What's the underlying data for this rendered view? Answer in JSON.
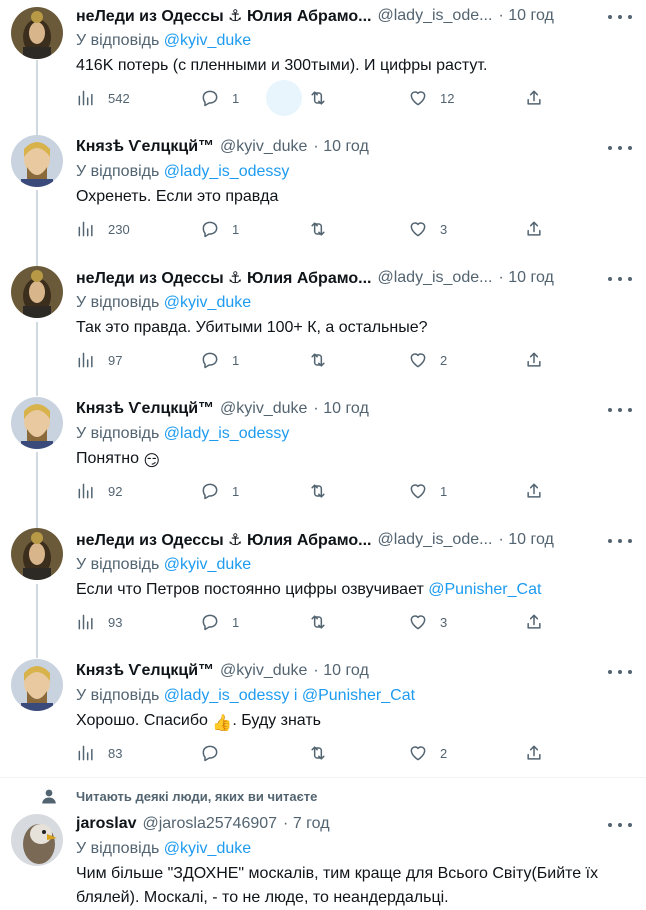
{
  "labels": {
    "replying_to": "У відповідь",
    "and": "і"
  },
  "tweets": [
    {
      "display_name": "неЛеди из Одессы ⚓ Юлия Абрамо...",
      "handle": "@lady_is_ode...",
      "time": "· 10 год",
      "reply_to_1": "@kyiv_duke",
      "text": "416K потерь (с пленными и 300тыми). И цифры растут.",
      "views": "542",
      "replies": "1",
      "retweets": "",
      "likes": "12"
    },
    {
      "display_name": "Князѣ Ѵелцкцй™",
      "handle": "@kyiv_duke",
      "time": "· 10 год",
      "reply_to_1": "@lady_is_odessy",
      "text": "Охренеть. Если это правда",
      "views": "230",
      "replies": "1",
      "retweets": "",
      "likes": "3"
    },
    {
      "display_name": "неЛеди из Одессы ⚓ Юлия Абрамо...",
      "handle": "@lady_is_ode...",
      "time": "· 10 год",
      "reply_to_1": "@kyiv_duke",
      "text": "Так это правда. Убитыми 100+ К, а остальные?",
      "views": "97",
      "replies": "1",
      "retweets": "",
      "likes": "2"
    },
    {
      "display_name": "Князѣ Ѵелцкцй™",
      "handle": "@kyiv_duke",
      "time": "· 10 год",
      "reply_to_1": "@lady_is_odessy",
      "text": "Понятно",
      "emoji": "😏",
      "views": "92",
      "replies": "1",
      "retweets": "",
      "likes": "1"
    },
    {
      "display_name": "неЛеди из Одессы ⚓ Юлия Абрамо...",
      "handle": "@lady_is_ode...",
      "time": "· 10 год",
      "reply_to_1": "@kyiv_duke",
      "text": "Если что Петров постоянно цифры озвучивает",
      "text_mention": "@Punisher_Cat",
      "views": "93",
      "replies": "1",
      "retweets": "",
      "likes": "3"
    },
    {
      "display_name": "Князѣ Ѵелцкцй™",
      "handle": "@kyiv_duke",
      "time": "· 10 год",
      "reply_to_1": "@lady_is_odessy",
      "reply_to_2": "@Punisher_Cat",
      "text": "Хорошо. Спасибо",
      "emoji": "👍",
      "text_after": ". Буду знать",
      "views": "83",
      "replies": "",
      "retweets": "",
      "likes": "2"
    }
  ],
  "social_context": "Читають деякі люди, яких ви читаєте",
  "last_tweet": {
    "display_name": "jaroslav",
    "handle": "@jarosla25746907",
    "time": "· 7 год",
    "reply_to_1": "@kyiv_duke",
    "text": "Чим більше \"ЗДОХНЕ\" москалів, тим краще для Всього Світу(Бийте їх блялей). Москалі, - то не люде, то неандердальці."
  },
  "colors": {
    "accent": "#1d9bf0",
    "secondary_text": "#536471",
    "thread_line": "#cfd9de"
  }
}
